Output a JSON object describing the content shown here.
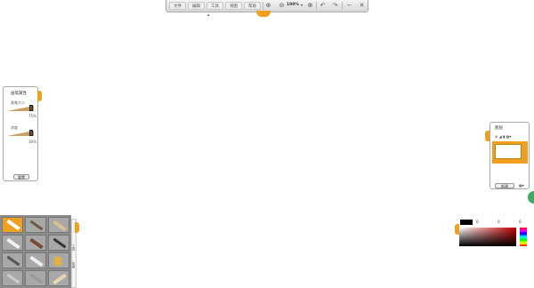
{
  "toolbar": {
    "menu": [
      "文件",
      "编辑",
      "工具",
      "视图",
      "帮助"
    ],
    "zoom": "100%",
    "icons": [
      "fit-screen-icon",
      "zoom-out-icon",
      "zoom-in-icon",
      "undo-icon",
      "redo-icon",
      "minimize-icon",
      "close-icon"
    ]
  },
  "brush_panel": {
    "title": "画笔属性",
    "size_label": "画笔大小",
    "size_value": "75%",
    "opacity_label": "浓度",
    "opacity_value": "36%",
    "reset_button": "重置"
  },
  "layer_panel": {
    "title": "图层",
    "new_layer_button": "新建"
  },
  "color_panel": {
    "fields": [
      "0",
      "0",
      "0"
    ]
  },
  "tool_grid": {
    "side_tabs": [
      "工具",
      "笔刷"
    ],
    "tools": [
      "marker",
      "pencil",
      "crayon",
      "eraser",
      "airbrush",
      "pen",
      "smudge",
      "bucket",
      "ruler",
      "scissors",
      "tape",
      "glue"
    ]
  },
  "colors": {
    "accent": "#f0a020",
    "panel_border": "#aaaaaa",
    "tool_bg": "#a8a8a8"
  }
}
